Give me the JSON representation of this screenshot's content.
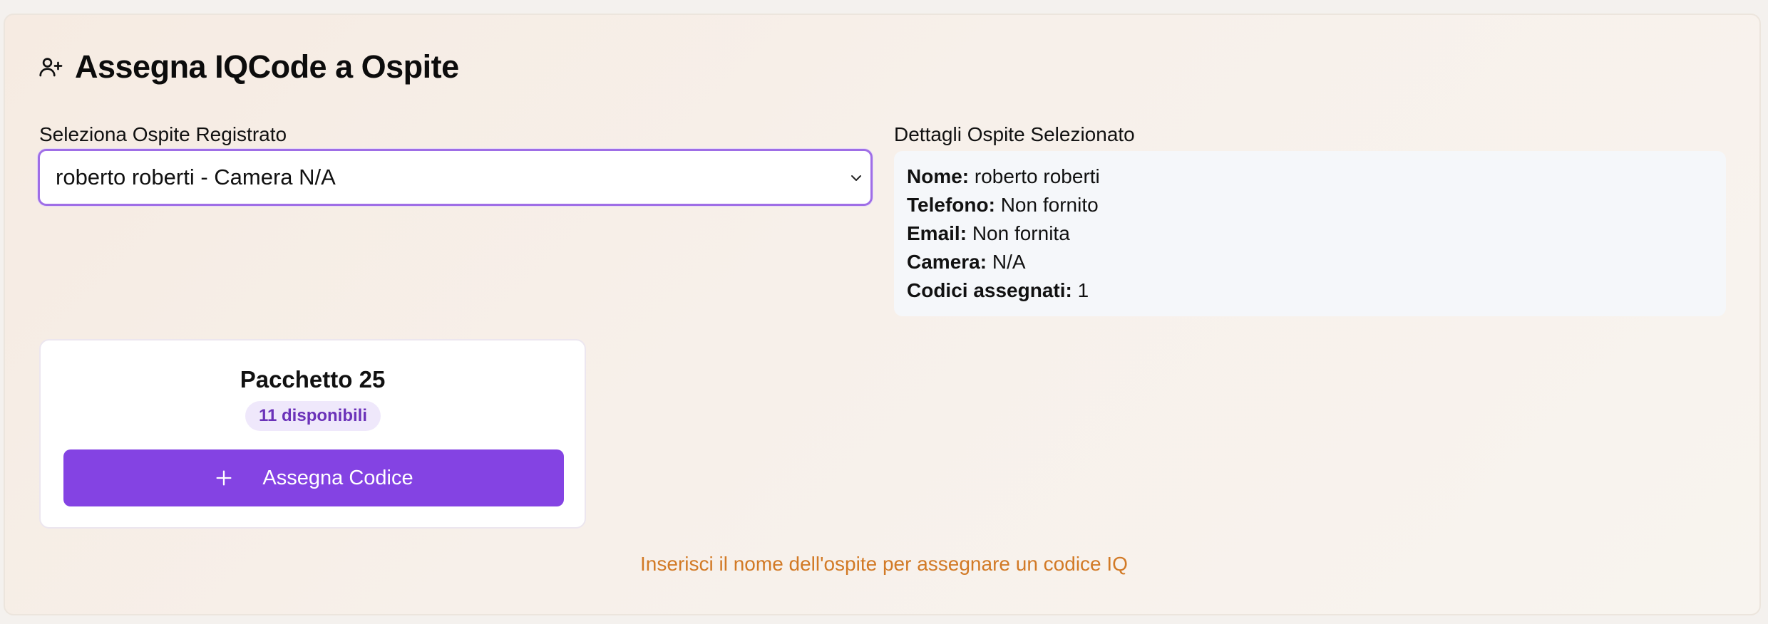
{
  "header": {
    "title": "Assegna IQCode a Ospite",
    "icon": "user-plus-icon"
  },
  "guest_select": {
    "label": "Seleziona Ospite Registrato",
    "selected": "roberto roberti - Camera N/A",
    "icon": "chevron-down-icon"
  },
  "details": {
    "label": "Dettagli Ospite Selezionato",
    "rows": [
      {
        "key": "Nome:",
        "value": "roberto roberti"
      },
      {
        "key": "Telefono:",
        "value": "Non fornito"
      },
      {
        "key": "Email:",
        "value": "Non fornita"
      },
      {
        "key": "Camera:",
        "value": "N/A"
      },
      {
        "key": "Codici assegnati:",
        "value": "1"
      }
    ]
  },
  "package": {
    "title": "Pacchetto 25",
    "badge": "11 disponibili",
    "button_label": "Assegna Codice",
    "button_icon": "plus-icon"
  },
  "hint": "Inserisci il nome dell'ospite per assegnare un codice IQ",
  "colors": {
    "accent": "#8443e3",
    "warning": "#d27a26",
    "select_border": "#9f6ee6"
  }
}
